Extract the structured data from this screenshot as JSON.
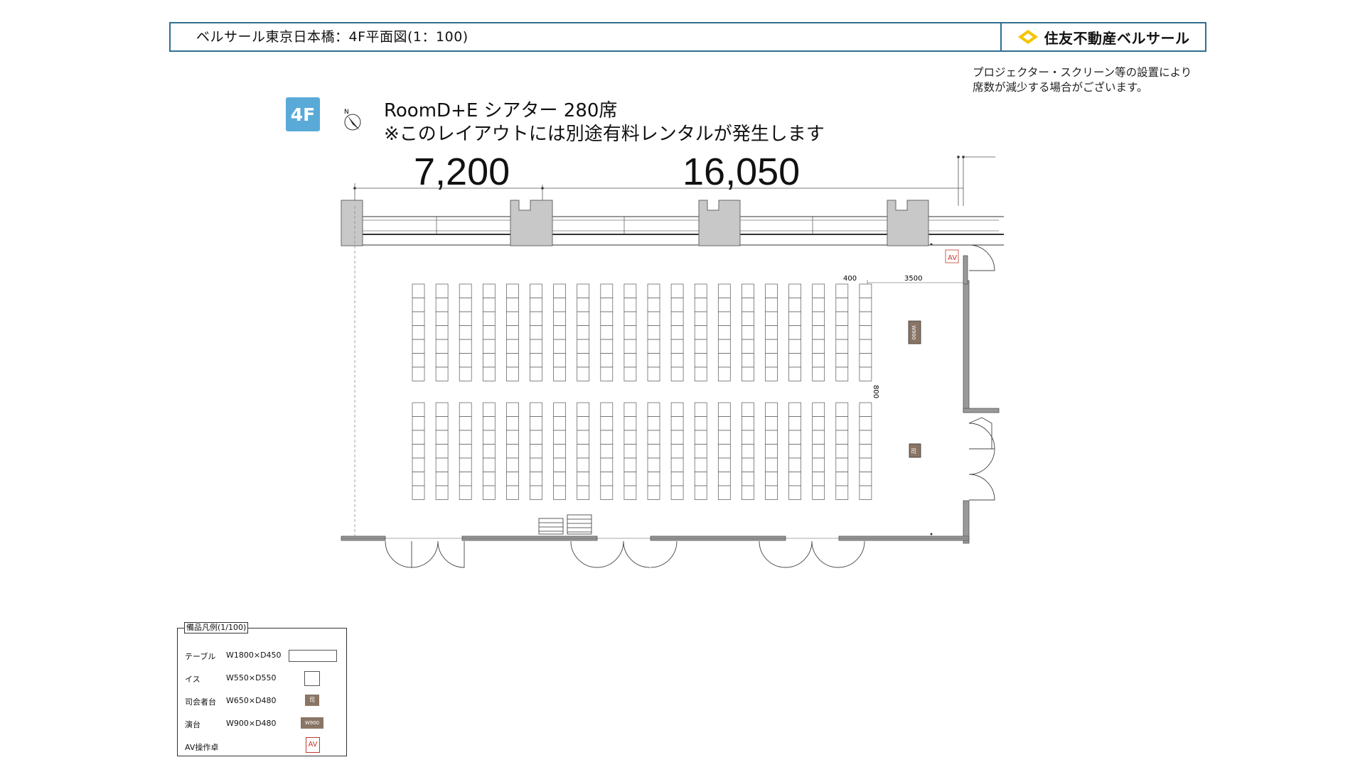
{
  "header": {
    "title": "ベルサール東京日本橋：4F平面図(1：100)",
    "brand": "住友不動産ベルサール"
  },
  "note": {
    "line1": "プロジェクター・スクリーン等の設置により",
    "line2": "席数が減少する場合がございます。"
  },
  "floor_badge": "4F",
  "layout": {
    "title": "RoomD+E シアター 280席",
    "subtitle": "※このレイアウトには別途有料レンタルが発生します"
  },
  "plan": {
    "compass_label": "N",
    "dimension_left": "7,200",
    "dimension_right": "16,050",
    "dim_400": "400",
    "dim_3500": "3500",
    "dim_800": "800",
    "av_label": "AV",
    "podium_label": "W900",
    "mc_label": "司",
    "chair_columns": 20,
    "chair_rows_per_block": 7,
    "chair_blocks": 2,
    "colors": {
      "wall": "#888888",
      "pillar_fill": "#c8c8c8",
      "furniture_brown": "#8a7565",
      "av_red": "#c0392b"
    }
  },
  "legend": {
    "title": "備品凡例(1/100)",
    "items": [
      {
        "label": "テーブル",
        "dim": "W1800×D450"
      },
      {
        "label": "イス",
        "dim": "W550×D550"
      },
      {
        "label": "司会者台",
        "dim": "W650×D480",
        "symbol": "司"
      },
      {
        "label": "演台",
        "dim": "W900×D480",
        "symbol": "W900"
      },
      {
        "label": "AV操作卓",
        "dim": "",
        "symbol": "AV"
      }
    ]
  }
}
